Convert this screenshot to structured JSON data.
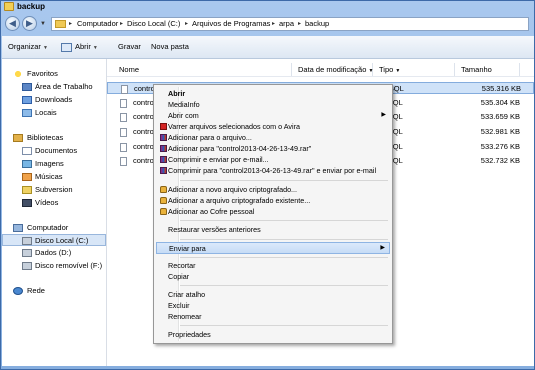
{
  "window": {
    "title": "backup"
  },
  "address": {
    "crumbs": [
      "Computador",
      "Disco Local (C:)",
      "Arquivos de Programas",
      "arpa",
      "backup"
    ]
  },
  "toolbar": {
    "organize": "Organizar",
    "open": "Abrir",
    "burn": "Gravar",
    "new_folder": "Nova pasta"
  },
  "sidebar": {
    "favorites": "Favoritos",
    "desktop": "Área de Trabalho",
    "downloads": "Downloads",
    "locais": "Locais",
    "libraries": "Bibliotecas",
    "documents": "Documentos",
    "images": "Imagens",
    "music": "Músicas",
    "subversion": "Subversion",
    "videos": "Vídeos",
    "computer": "Computador",
    "disk_c": "Disco Local (C:)",
    "disk_d": "Dados (D:)",
    "removable": "Disco removível (F:)",
    "network": "Rede"
  },
  "columns": {
    "name": "Nome",
    "modified": "Data de modificação",
    "type": "Tipo",
    "size": "Tamanho"
  },
  "files": [
    {
      "name": "contro",
      "type": "ro SQL",
      "size": "535.316 KB"
    },
    {
      "name": "contro",
      "type": "ro SQL",
      "size": "535.304 KB"
    },
    {
      "name": "contro",
      "type": "ro SQL",
      "size": "533.659 KB"
    },
    {
      "name": "contro",
      "type": "ro SQL",
      "size": "532.981 KB"
    },
    {
      "name": "contro",
      "type": "ro SQL",
      "size": "533.276 KB"
    },
    {
      "name": "contro",
      "type": "ro SQL",
      "size": "532.732 KB"
    }
  ],
  "menu": {
    "open": "Abrir",
    "mediainfo": "MediaInfo",
    "open_with": "Abrir com",
    "avira": "Varrer arquivos selecionados com o Avira",
    "add_archive": "Adicionar para o arquivo...",
    "add_rar": "Adicionar para \"control2013-04-26-13-49.rar\"",
    "compress_email": "Comprimir e enviar por e-mail...",
    "compress_rar_email": "Comprimir para \"control2013-04-26-13-49.rar\" e enviar por e-mail",
    "add_new_encrypted": "Adicionar a novo arquivo criptografado...",
    "add_existing_encrypted": "Adicionar a arquivo criptografado existente...",
    "add_vault": "Adicionar ao Cofre pessoal",
    "restore": "Restaurar versões anteriores",
    "send_to": "Enviar para",
    "cut": "Recortar",
    "copy": "Copiar",
    "shortcut": "Criar atalho",
    "delete": "Excluir",
    "rename": "Renomear",
    "properties": "Propriedades"
  },
  "colors": {
    "frame": "#86aedf",
    "selection": "#cfe2f8",
    "menu_highlight": "#c6dcf6"
  }
}
